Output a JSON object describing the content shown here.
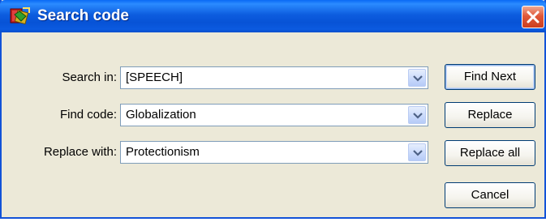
{
  "window": {
    "title": "Search code",
    "icon": "search-code-app-icon",
    "close_icon": "close-icon"
  },
  "colors": {
    "titlebar": "#0a5ce0",
    "window_bg": "#ece9d8",
    "close_button": "#e0583a",
    "field_border": "#7f9db9",
    "button_border": "#003c74"
  },
  "form": {
    "search_in": {
      "label": "Search in:",
      "value": "[SPEECH]"
    },
    "find_code": {
      "label": "Find code:",
      "value": "Globalization"
    },
    "replace_with": {
      "label": "Replace with:",
      "value": "Protectionism"
    }
  },
  "buttons": {
    "find_next": "Find Next",
    "replace": "Replace",
    "replace_all": "Replace all",
    "cancel": "Cancel"
  }
}
